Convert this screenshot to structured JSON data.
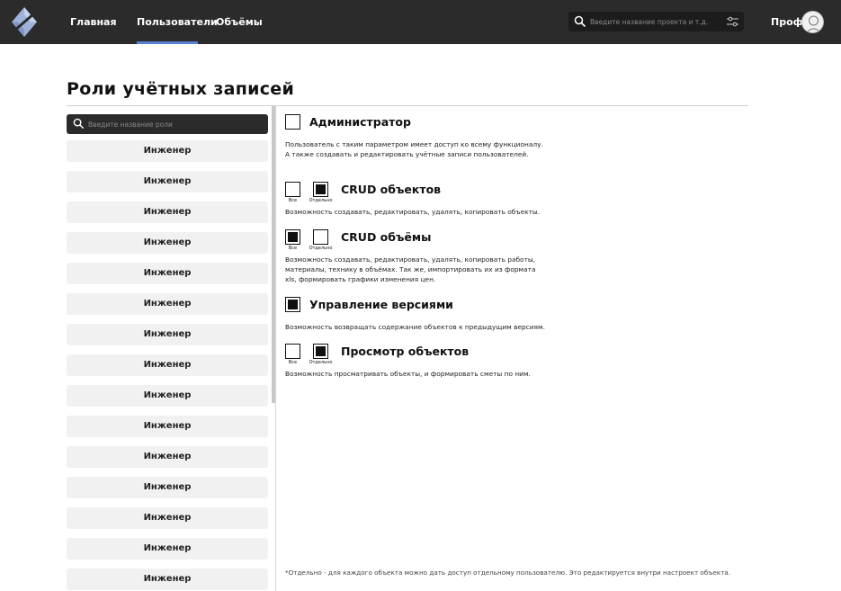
{
  "header": {
    "nav": [
      {
        "label": "Главная",
        "active": false
      },
      {
        "label": "Пользователи",
        "active": true
      },
      {
        "label": "Объёмы",
        "active": false
      }
    ],
    "search_placeholder": "Введите название проекта и т.д.",
    "profile_label": "Профиль",
    "accent_color": "#5b7fd1"
  },
  "page": {
    "title": "Роли учётных записей"
  },
  "roles": {
    "search_placeholder": "Введите название роли",
    "items": [
      "Инженер",
      "Инженер",
      "Инженер",
      "Инженер",
      "Инженер",
      "Инженер",
      "Инженер",
      "Инженер",
      "Инженер",
      "Инженер",
      "Инженер",
      "Инженер",
      "Инженер",
      "Инженер",
      "Инженер"
    ]
  },
  "permissions": {
    "all_label": "Все",
    "separate_label": "Отдельно",
    "items": [
      {
        "title": "Администратор",
        "description": "Пользователь с таким параметром имеет доступ ко всему функционалу. А также создавать и редактировать учётные записи пользователей.",
        "has_separate": false,
        "all_checked": false
      },
      {
        "title": "CRUD объектов",
        "description": "Возможность создавать, редактировать, удалять, копировать объекты.",
        "has_separate": true,
        "all_checked": false,
        "separate_checked": true
      },
      {
        "title": "CRUD объёмы",
        "description": "Возможность создавать, редактировать, удалять, копировать работы, материалы, технику в объёмах. Так же, импортировать их из формата xls, формировать графики изменения цен.",
        "has_separate": true,
        "all_checked": true,
        "separate_checked": false
      },
      {
        "title": "Управление версиями",
        "description": "Возможность возвращать содержание объектов к предыдущим версиям.",
        "has_separate": false,
        "all_checked": true
      },
      {
        "title": "Просмотр объектов",
        "description": "Возможность просматривать объекты, и формировать сметы по ним.",
        "has_separate": true,
        "all_checked": false,
        "separate_checked": true
      }
    ],
    "footnote": "*Отдельно - для каждого объекта можно дать доступ отдельному пользователю. Это редактируется внутри настроект объекта."
  }
}
